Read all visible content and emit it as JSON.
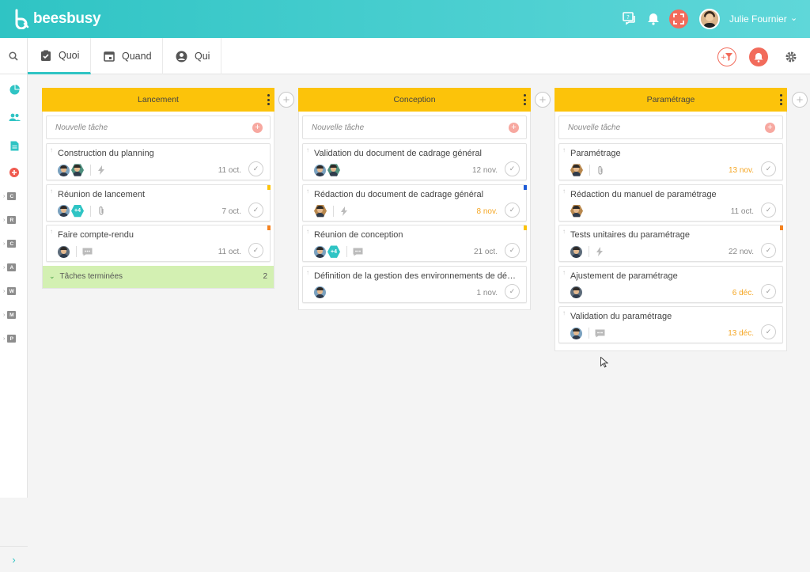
{
  "app": {
    "brand": "beesbusy"
  },
  "topbar": {
    "user_name": "Julie Fournier",
    "icons": [
      "chat-icon",
      "bell-icon",
      "fullscreen-icon",
      "user-avatar",
      "chevron-down-icon"
    ]
  },
  "tabs": [
    {
      "label": "Quoi",
      "icon": "clipboard-check-icon",
      "active": true
    },
    {
      "label": "Quand",
      "icon": "calendar-icon",
      "active": false
    },
    {
      "label": "Qui",
      "icon": "user-circle-icon",
      "active": false
    }
  ],
  "sidebar": {
    "icons": [
      "pie-chart-icon",
      "team-icon",
      "document-icon",
      "add-project-icon"
    ],
    "projects": [
      "C",
      "R",
      "C",
      "A",
      "W",
      "M",
      "P"
    ]
  },
  "colors": {
    "accent": "#2fc4c4",
    "column_header": "#fcc30a",
    "late": "#f5a623",
    "done_bg": "#d3f0b2",
    "danger": "#f26b5b"
  },
  "board": {
    "new_task_placeholder": "Nouvelle tâche",
    "columns": [
      {
        "title": "Lancement",
        "cards": [
          {
            "title": "Construction du planning",
            "date": "11 oct.",
            "late": false
          },
          {
            "title": "Réunion de lancement",
            "date": "7 oct.",
            "late": false,
            "plus": "+4"
          },
          {
            "title": "Faire compte-rendu",
            "date": "11 oct.",
            "late": false
          }
        ],
        "done_label": "Tâches terminées",
        "done_count": "2"
      },
      {
        "title": "Conception",
        "cards": [
          {
            "title": "Validation du document de cadrage général",
            "date": "12 nov.",
            "late": false
          },
          {
            "title": "Rédaction du document de cadrage général",
            "date": "8 nov.",
            "late": true
          },
          {
            "title": "Réunion de conception",
            "date": "21 oct.",
            "late": false,
            "plus": "+4"
          },
          {
            "title": "Définition de la gestion des environnements de dével...",
            "date": "1 nov.",
            "late": false
          }
        ]
      },
      {
        "title": "Paramétrage",
        "cards": [
          {
            "title": "Paramétrage",
            "date": "13 nov.",
            "late": true
          },
          {
            "title": "Rédaction du manuel de paramétrage",
            "date": "11 oct.",
            "late": false
          },
          {
            "title": "Tests unitaires du paramétrage",
            "date": "22 nov.",
            "late": false
          },
          {
            "title": "Ajustement de paramétrage",
            "date": "6 déc.",
            "late": true
          },
          {
            "title": "Validation du paramétrage",
            "date": "13 déc.",
            "late": true
          }
        ]
      }
    ]
  }
}
